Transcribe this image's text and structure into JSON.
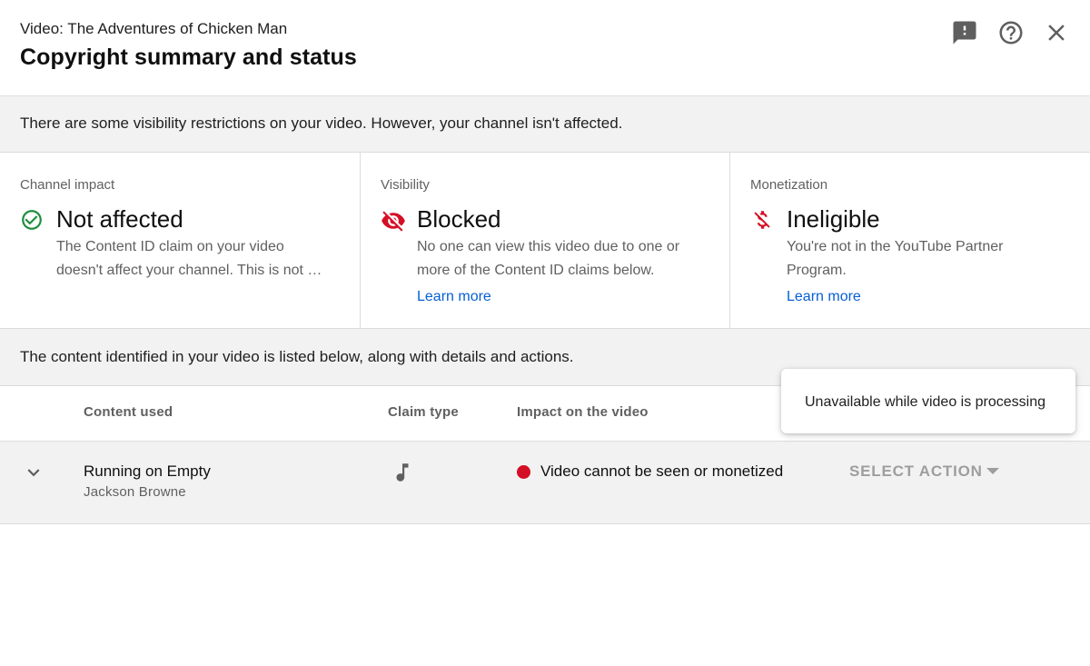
{
  "header": {
    "subtitle": "Video: The Adventures of Chicken Man",
    "title": "Copyright summary and status",
    "icons": [
      "feedback-icon",
      "help-icon",
      "close-icon"
    ]
  },
  "banner": {
    "text": "There are some visibility restrictions on your video. However, your channel isn't affected."
  },
  "panels": {
    "channel_impact": {
      "label": "Channel impact",
      "status": "Not affected",
      "desc_line1": "The Content ID claim on your video",
      "desc_line2": "doesn't affect your channel. This is not …",
      "icon": "check-circle-icon",
      "color": "#1e8e3e"
    },
    "visibility": {
      "label": "Visibility",
      "status": "Blocked",
      "desc_line1": "No one can view this video due to one or",
      "desc_line2": "more of the Content ID claims below.",
      "link": "Learn more",
      "icon": "visibility-off-icon",
      "color": "#d50f25"
    },
    "monetization": {
      "label": "Monetization",
      "status": "Ineligible",
      "desc_line1": "You're not in the YouTube Partner",
      "desc_line2": "Program.",
      "link": "Learn more",
      "icon": "money-off-icon",
      "color": "#d50f25"
    }
  },
  "content_banner": {
    "text": "The content identified in your video is listed below, along with details and actions."
  },
  "table": {
    "columns": {
      "content": "Content used",
      "claim": "Claim type",
      "impact": "Impact on the video"
    },
    "rows": [
      {
        "title": "Running on Empty",
        "artist": "Jackson Browne",
        "claim_icon": "music-note-icon",
        "impact": "Video cannot be seen or monetized",
        "impact_color": "#d50f25",
        "action": "SELECT ACTION"
      }
    ]
  },
  "tooltip": {
    "text": "Unavailable while video is processing"
  },
  "colors": {
    "link": "#065fd4",
    "banner_bg": "#f2f2f2",
    "muted_text": "#606060"
  }
}
